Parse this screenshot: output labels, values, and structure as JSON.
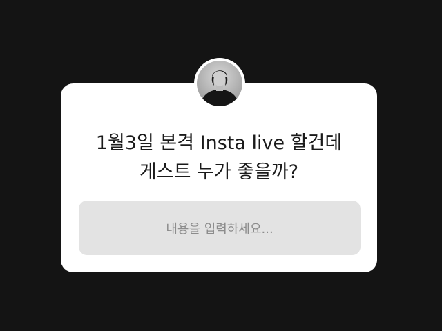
{
  "question_sticker": {
    "question_lines": [
      "1월3일 본격 Insta live 할건데",
      "게스트 누가 좋을까?"
    ],
    "answer_placeholder": "내용을 입력하세요..."
  },
  "colors": {
    "background": "#141414",
    "card": "#ffffff",
    "input_background": "#e3e3e3",
    "placeholder_text": "#8c8c8c",
    "question_text": "#1a1a1a"
  },
  "icons": {
    "avatar": "profile-photo"
  }
}
